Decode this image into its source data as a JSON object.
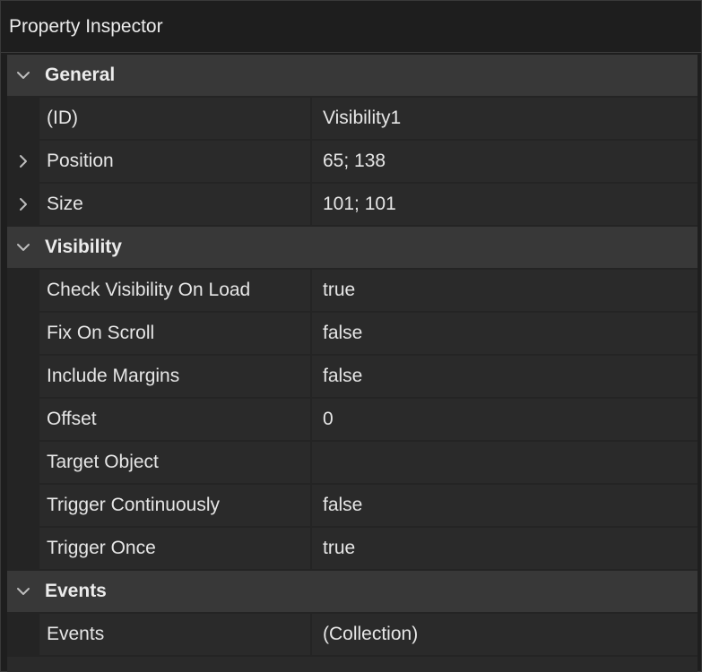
{
  "panel": {
    "title": "Property Inspector"
  },
  "sections": {
    "general": {
      "title": "General",
      "rows": {
        "id": {
          "name": "(ID)",
          "value": "Visibility1"
        },
        "position": {
          "name": "Position",
          "value": "65; 138"
        },
        "size": {
          "name": "Size",
          "value": "101; 101"
        }
      }
    },
    "visibility": {
      "title": "Visibility",
      "rows": {
        "check_visibility_on_load": {
          "name": "Check Visibility On Load",
          "value": "true"
        },
        "fix_on_scroll": {
          "name": "Fix On Scroll",
          "value": "false"
        },
        "include_margins": {
          "name": "Include Margins",
          "value": "false"
        },
        "offset": {
          "name": "Offset",
          "value": "0"
        },
        "target_object": {
          "name": "Target Object",
          "value": ""
        },
        "trigger_continuously": {
          "name": "Trigger Continuously",
          "value": "false"
        },
        "trigger_once": {
          "name": "Trigger Once",
          "value": "true"
        }
      }
    },
    "events": {
      "title": "Events",
      "rows": {
        "events": {
          "name": "Events",
          "value": "(Collection)"
        }
      }
    }
  },
  "icons": {
    "section_toggle": "chevron-down-icon",
    "row_expand": "chevron-right-icon"
  }
}
